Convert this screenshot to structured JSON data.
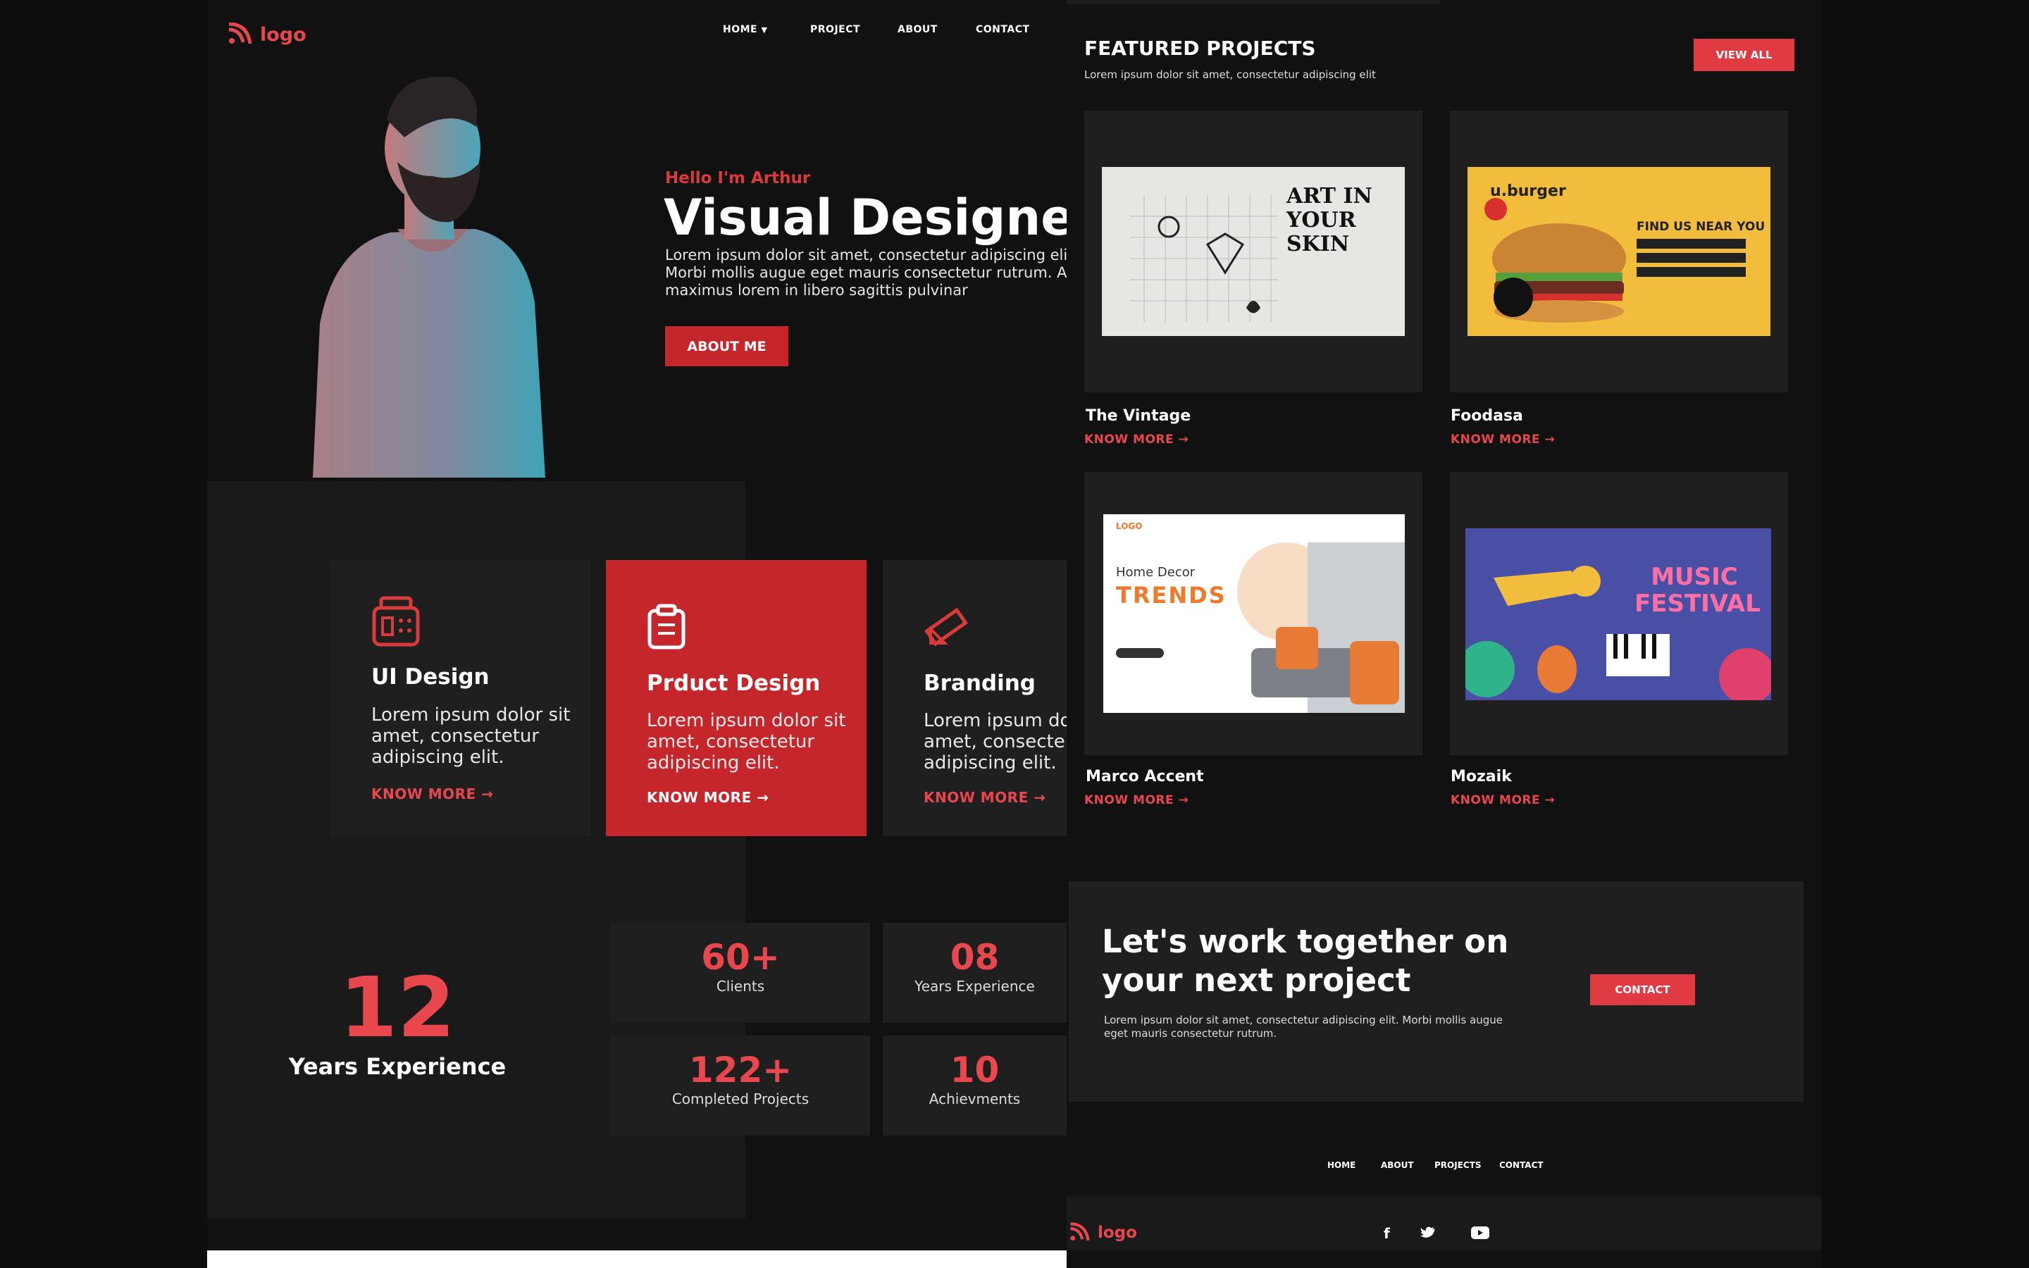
{
  "left": {
    "logo_text": "logo",
    "nav": [
      "HOME",
      "PROJECT",
      "ABOUT",
      "CONTACT"
    ],
    "hero": {
      "greeting": "Hello I'm Arthur",
      "title": "Visual Designer",
      "desc_lines": [
        "Lorem ipsum dolor sit amet, consectetur adipiscing elit.",
        "Morbi mollis augue eget mauris consectetur rutrum. Ali",
        "maximus lorem in libero sagittis pulvinar"
      ],
      "button": "ABOUT ME"
    },
    "services": [
      {
        "title": "UI Design",
        "text": [
          "Lorem ipsum dolor sit",
          "amet, consectetur",
          "adipiscing elit."
        ],
        "link": "KNOW MORE"
      },
      {
        "title": "Prduct Design",
        "text": [
          "Lorem ipsum dolor sit",
          "amet, consectetur",
          "adipiscing elit."
        ],
        "link": "KNOW MORE"
      },
      {
        "title": "Branding",
        "text": [
          "Lorem ipsum do",
          "amet, consecte",
          "adipiscing elit."
        ],
        "link": "KNOW MORE"
      }
    ],
    "experience": {
      "number": "12",
      "label": "Years Experience"
    },
    "stats": [
      {
        "num": "60+",
        "label": "Clients"
      },
      {
        "num": "08",
        "label": "Years Experience"
      },
      {
        "num": "122+",
        "label": "Completed Projects"
      },
      {
        "num": "10",
        "label": "Achievments"
      }
    ]
  },
  "right": {
    "heading": "FEATURED PROJECTS",
    "subheading": "Lorem ipsum dolor sit amet, consectetur adipiscing elit",
    "view_all": "VIEW ALL",
    "projects": [
      {
        "title": "The Vintage",
        "link": "KNOW MORE"
      },
      {
        "title": "Foodasa",
        "link": "KNOW MORE"
      },
      {
        "title": "Marco Accent",
        "link": "KNOW MORE"
      },
      {
        "title": "Mozaik",
        "link": "KNOW MORE"
      }
    ],
    "thumb_text": {
      "vintage": "ART IN YOUR SKIN",
      "foodasa_brand": "u.burger",
      "foodasa_head": "FIND US NEAR YOU",
      "marco_brand": "LOGO",
      "marco_small": "Home  Decor",
      "marco_big": "TRENDS",
      "mozaik": "MUSIC FESTIVAL"
    },
    "cta": {
      "line1": "Let's work together on",
      "line2": "your next project",
      "desc1": "Lorem ipsum dolor sit amet, consectetur adipiscing elit. Morbi mollis augue",
      "desc2": "eget mauris consectetur rutrum.",
      "button": "CONTACT"
    },
    "footer_nav": [
      "HOME",
      "ABOUT",
      "PROJECTS",
      "CONTACT"
    ],
    "footer_logo": "logo",
    "social": [
      "facebook-icon",
      "twitter-icon",
      "youtube-icon"
    ]
  },
  "colors": {
    "accent": "#d93a3a",
    "dark": "#111111",
    "card": "#1f1f1f"
  }
}
